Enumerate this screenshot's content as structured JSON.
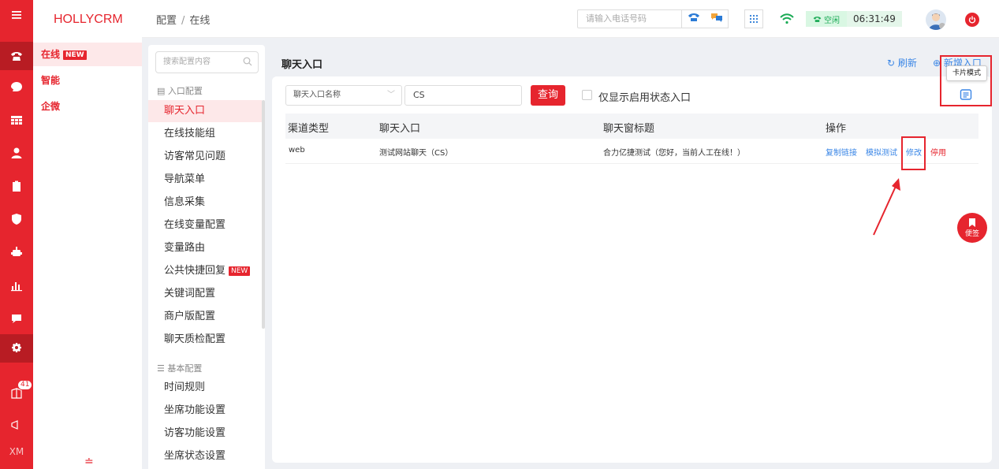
{
  "app": {
    "logo": "HOLLYCRM"
  },
  "rail": {
    "badge_count": "41",
    "footer_text": "XM"
  },
  "subnav": {
    "items": [
      {
        "label": "在线",
        "badge": "NEW"
      },
      {
        "label": "智能"
      },
      {
        "label": "企微"
      }
    ],
    "bottom_glyph": "≐"
  },
  "topbar": {
    "breadcrumb": [
      "配置",
      "在线"
    ],
    "breadcrumb_sep": "/",
    "phone_placeholder": "请输入电话号码",
    "status_label": "空闲",
    "clock": "06:31:49"
  },
  "config_menu": {
    "search_placeholder": "搜索配置内容",
    "group1": "入口配置",
    "items1": [
      {
        "label": "聊天入口"
      },
      {
        "label": "在线技能组"
      },
      {
        "label": "访客常见问题"
      },
      {
        "label": "导航菜单"
      },
      {
        "label": "信息采集"
      },
      {
        "label": "在线变量配置"
      },
      {
        "label": "变量路由"
      },
      {
        "label": "公共快捷回复",
        "badge": "NEW"
      },
      {
        "label": "关键词配置"
      },
      {
        "label": "商户版配置"
      },
      {
        "label": "聊天质检配置"
      }
    ],
    "group2": "基本配置",
    "items2": [
      {
        "label": "时间规则"
      },
      {
        "label": "坐席功能设置"
      },
      {
        "label": "访客功能设置"
      },
      {
        "label": "坐席状态设置"
      }
    ]
  },
  "main": {
    "title": "聊天入口",
    "refresh_label": "刷新",
    "new_label": "新增入口",
    "tooltip": "卡片模式",
    "filter": {
      "select_value": "聊天入口名称",
      "input_value": "CS",
      "query_label": "查询",
      "checkbox_label": "仅显示启用状态入口"
    },
    "table": {
      "headers": [
        "渠道类型",
        "聊天入口",
        "聊天窗标题",
        "操作"
      ],
      "rows": [
        {
          "channel": "web",
          "entry": "测试网站聊天（CS）",
          "window_title": "合力亿捷测试（您好，当前人工在线！）",
          "actions": [
            "复制链接",
            "模拟测试",
            "修改",
            "停用"
          ]
        }
      ]
    }
  },
  "fab": {
    "label": "便签"
  },
  "colors": {
    "brand": "#e6252e",
    "link": "#3a86e6",
    "status_green": "#1aaa55"
  }
}
